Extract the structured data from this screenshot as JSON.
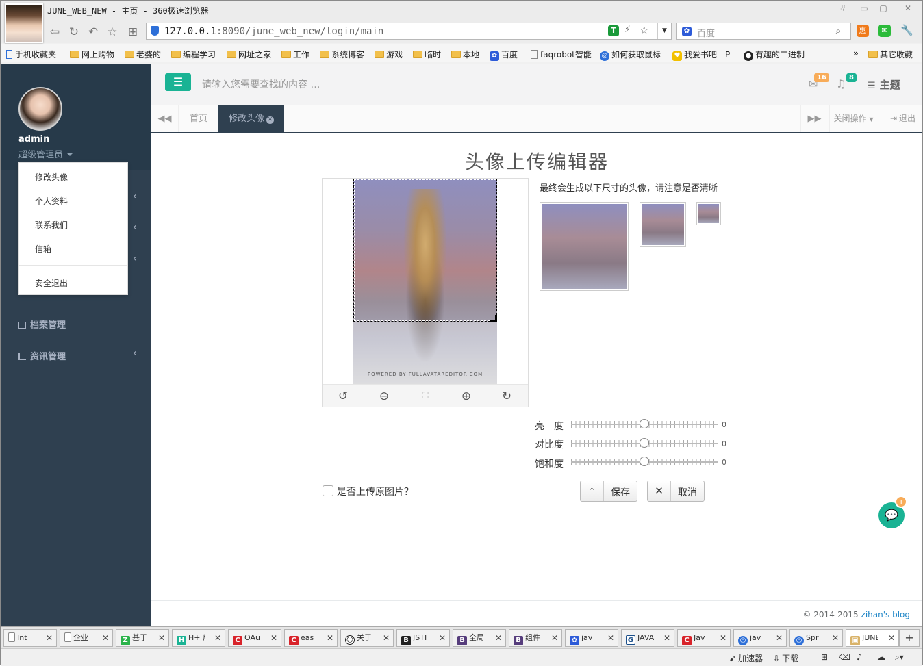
{
  "browser": {
    "title": "JUNE_WEB_NEW - 主页 - 360极速浏览器",
    "url_host": "127.0.0.1",
    "url_rest": ":8090/june_web_new/login/main",
    "search_engine": "百度",
    "bookmarks": [
      "手机收藏夹",
      "网上购物",
      "老婆的",
      "编程学习",
      "网址之家",
      "工作",
      "系统博客",
      "游戏",
      "临时",
      "本地",
      "百度",
      "faqrobot智能",
      "如何获取鼠标",
      "我爱书吧 - P",
      "有趣的二进制",
      "其它收藏"
    ],
    "bookmarks_more": "»",
    "tabs": [
      {
        "icon": "page-icon",
        "label": "Int"
      },
      {
        "icon": "page-icon",
        "label": "企业"
      },
      {
        "icon": "z-icon",
        "label": "基于"
      },
      {
        "icon": "h-plus-icon",
        "label": "H+ 后"
      },
      {
        "icon": "c-icon",
        "label": "OAu"
      },
      {
        "icon": "c-icon",
        "label": "eas"
      },
      {
        "icon": "face-icon",
        "label": "关于"
      },
      {
        "icon": "b-icon",
        "label": "JSTI"
      },
      {
        "icon": "b-icon",
        "label": "全局"
      },
      {
        "icon": "b-icon",
        "label": "组件"
      },
      {
        "icon": "paw-icon",
        "label": "jav"
      },
      {
        "icon": "g-icon",
        "label": "JAVA"
      },
      {
        "icon": "c-icon",
        "label": "Jav"
      },
      {
        "icon": "globe-icon",
        "label": "jav"
      },
      {
        "icon": "globe-icon",
        "label": "Spr"
      },
      {
        "icon": "image-icon",
        "label": "JUNE"
      }
    ],
    "status": {
      "accelerator": "加速器",
      "download": "下载"
    }
  },
  "sidebar": {
    "user_name": "admin",
    "user_role": "超级管理员",
    "dropdown": [
      "修改头像",
      "个人资料",
      "联系我们",
      "信箱"
    ],
    "dropdown_logout": "安全退出",
    "menus": [
      {
        "label": "档案管理"
      },
      {
        "label": "资讯管理"
      }
    ]
  },
  "topbar": {
    "search_placeholder": "请输入您需要查找的内容 …",
    "mail_count": "16",
    "alert_count": "8",
    "theme_label": "主题"
  },
  "tabsbar": {
    "tabs": [
      "首页",
      "修改头像"
    ],
    "close_ops": "关闭操作",
    "logout": "退出"
  },
  "editor": {
    "title": "头像上传编辑器",
    "watermark": "POWERED BY FULLAVATAREDITOR.COM",
    "preview_hint": "最终会生成以下尺寸的头像，请注意是否清晰",
    "sliders": [
      {
        "label": "亮　度",
        "value": "0"
      },
      {
        "label": "对比度",
        "value": "0"
      },
      {
        "label": "饱和度",
        "value": "0"
      }
    ],
    "upload_original_label": "是否上传原图片？",
    "save_label": "保存",
    "cancel_label": "取消"
  },
  "footer": {
    "copyright": "© 2014-2015 ",
    "blog_link": "zihan's blog"
  },
  "chat": {
    "badge": "1"
  },
  "colors": {
    "accent": "#1ab394",
    "sidebar": "#2f4050",
    "warning": "#f8ac59"
  }
}
